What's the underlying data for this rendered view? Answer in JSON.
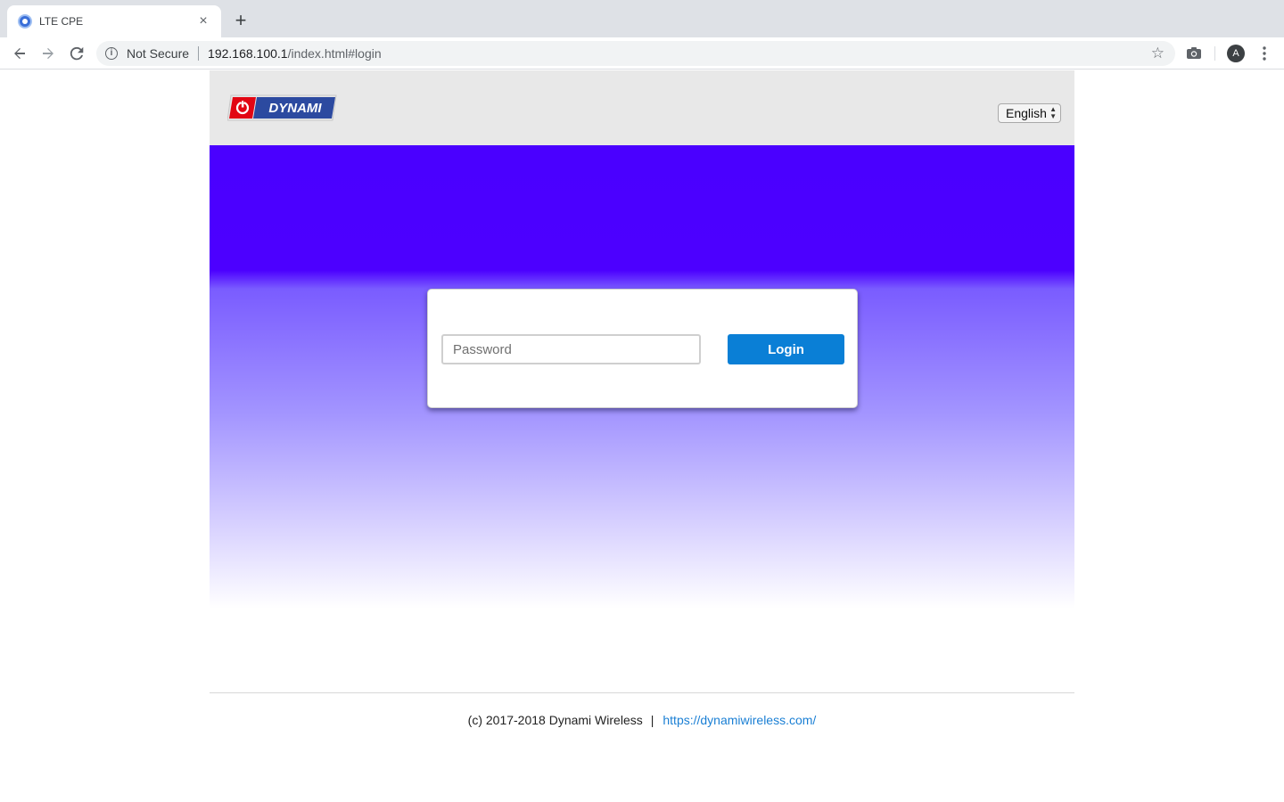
{
  "browser": {
    "tab_title": "LTE CPE",
    "tab_close": "×",
    "new_tab": "+",
    "security_label": "Not Secure",
    "url_host": "192.168.100.1",
    "url_path": "/index.html#login",
    "profile_initial": "A",
    "icons": {
      "back": "arrow-left",
      "forward": "arrow-right",
      "reload": "reload",
      "info": "info-circle",
      "bookmark": "star-outline",
      "camera": "camera",
      "menu": "vertical-dots"
    }
  },
  "header": {
    "logo_text": "DYNAMI",
    "language": {
      "selected": "English"
    },
    "background_color": "#e8e8e8"
  },
  "login": {
    "password_placeholder": "Password",
    "password_value": "",
    "login_label": "Login",
    "button_color": "#0a7fd6"
  },
  "hero": {
    "gradient_top_color": "#4a00ff",
    "gradient_bottom_color": "#ffffff"
  },
  "footer": {
    "copyright": "(c) 2017-2018 Dynami Wireless",
    "separator": "|",
    "link_text": "https://dynamiwireless.com/",
    "link_color": "#1a7fd4"
  }
}
